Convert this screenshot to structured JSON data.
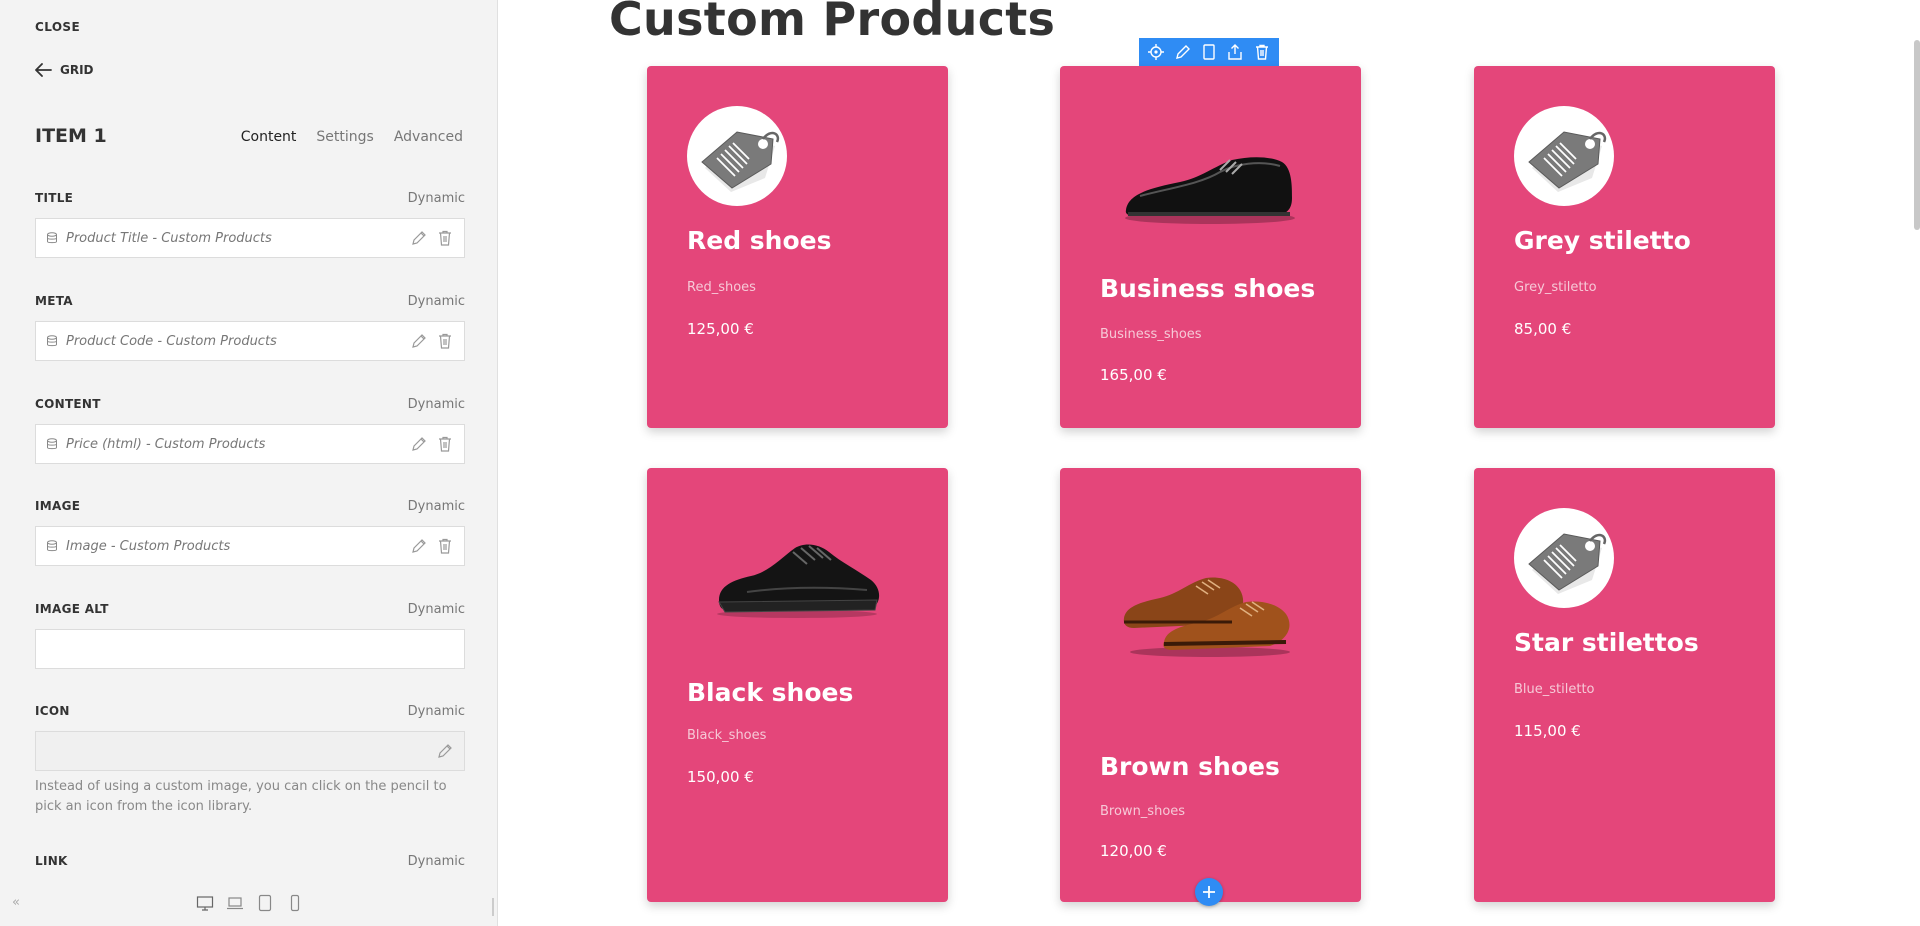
{
  "sidebar": {
    "close_label": "CLOSE",
    "back_label": "GRID",
    "item_title": "ITEM 1",
    "tabs": [
      {
        "label": "Content",
        "active": true
      },
      {
        "label": "Settings",
        "active": false
      },
      {
        "label": "Advanced",
        "active": false
      }
    ],
    "fields": [
      {
        "label": "TITLE",
        "dynamic": "Dynamic",
        "value": "Product Title - Custom Products"
      },
      {
        "label": "META",
        "dynamic": "Dynamic",
        "value": "Product Code - Custom Products"
      },
      {
        "label": "CONTENT",
        "dynamic": "Dynamic",
        "value": "Price (html) - Custom Products"
      },
      {
        "label": "IMAGE",
        "dynamic": "Dynamic",
        "value": "Image - Custom Products"
      },
      {
        "label": "IMAGE ALT",
        "dynamic": "Dynamic",
        "value": ""
      },
      {
        "label": "ICON",
        "dynamic": "Dynamic",
        "value": ""
      },
      {
        "label": "LINK",
        "dynamic": "Dynamic",
        "value": ""
      }
    ],
    "icon_help": "Instead of using a custom image, you can click on the pencil to pick an icon from the icon library.",
    "collapse_label": "«",
    "device_icons": [
      "desktop-icon",
      "laptop-icon",
      "tablet-icon",
      "phone-icon"
    ]
  },
  "canvas": {
    "page_title": "Custom Products",
    "toolbar_icons": [
      "move-icon",
      "edit-icon",
      "copy-icon",
      "share-icon",
      "delete-icon"
    ],
    "products": [
      {
        "title": "Red shoes",
        "meta": "Red_shoes",
        "price": "125,00 €",
        "image": "price-tag"
      },
      {
        "title": "Business shoes",
        "meta": "Business_shoes",
        "price": "165,00 €",
        "image": "black-dress-shoe"
      },
      {
        "title": "Grey stiletto",
        "meta": "Grey_stiletto",
        "price": "85,00 €",
        "image": "price-tag"
      },
      {
        "title": "Black shoes",
        "meta": "Black_shoes",
        "price": "150,00 €",
        "image": "black-sneaker"
      },
      {
        "title": "Brown shoes",
        "meta": "Brown_shoes",
        "price": "120,00 €",
        "image": "brown-shoes"
      },
      {
        "title": "Star stilettos",
        "meta": "Blue_stiletto",
        "price": "115,00 €",
        "image": "price-tag"
      }
    ],
    "colors": {
      "card": "#e4467a",
      "accent": "#2f8cf4"
    }
  }
}
